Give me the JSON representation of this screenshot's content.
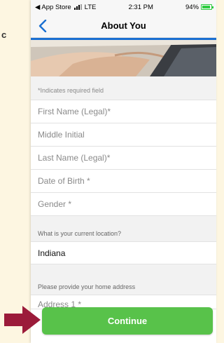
{
  "side_letter": "c",
  "status": {
    "carrier": "◀ App Store",
    "network": "LTE",
    "time": "2:31 PM",
    "battery_text": "94%",
    "battery_level": 0.94,
    "battery_color": "#2ecc40"
  },
  "nav": {
    "title": "About You",
    "back_icon": "chevron-left-icon"
  },
  "form": {
    "required_note": "*Indicates required field",
    "fields": [
      {
        "placeholder": "First Name (Legal)*"
      },
      {
        "placeholder": "Middle Initial"
      },
      {
        "placeholder": "Last Name (Legal)*"
      },
      {
        "placeholder": "Date of Birth *"
      },
      {
        "placeholder": "Gender *"
      }
    ],
    "location_label": "What is your current location?",
    "location_value": "Indiana",
    "address_label": "Please provide your home address",
    "address1_placeholder": "Address 1 *"
  },
  "continue_label": "Continue",
  "colors": {
    "accent_blue": "#1a6fd1",
    "continue_green": "#58c24a",
    "pointer_arrow": "#9b1b3a",
    "page_background": "#fdf6e1"
  }
}
